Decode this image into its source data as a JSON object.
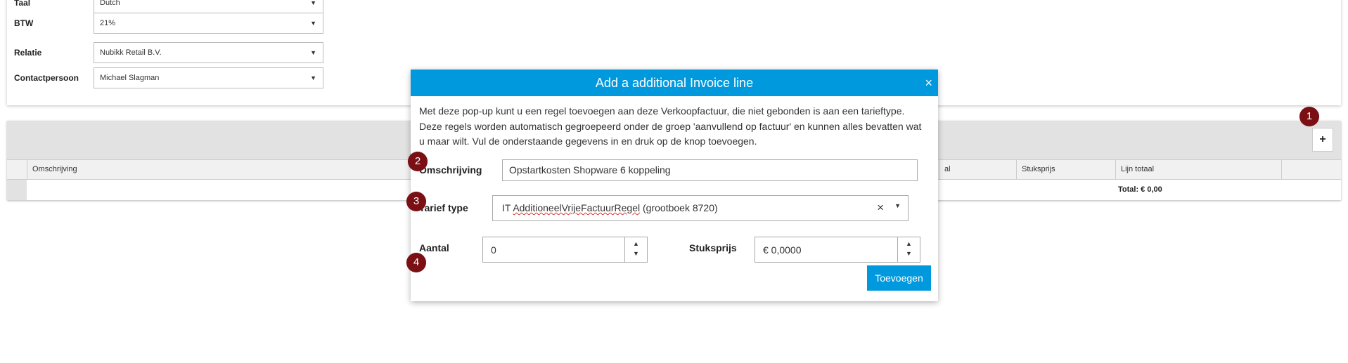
{
  "settings": {
    "rows": [
      {
        "label": "Taal",
        "value": "Dutch"
      },
      {
        "label": "BTW",
        "value": "21%"
      },
      {
        "label": "Relatie",
        "value": "Nubikk Retail B.V."
      },
      {
        "label": "Contactpersoon",
        "value": "Michael Slagman"
      }
    ]
  },
  "lines_table": {
    "add_button": "+",
    "columns": [
      "Omschrijving",
      "al",
      "Stuksprijs",
      "Lijn totaal"
    ],
    "total": "Total: € 0,00"
  },
  "modal": {
    "title": "Add a additional Invoice line",
    "close": "×",
    "description": "Met deze pop-up kunt u een regel toevoegen aan deze Verkoopfactuur, die niet gebonden is aan een tarieftype. Deze regels worden automatisch gegroepeerd onder de groep 'aanvullend op factuur' en kunnen alles bevatten wat u maar wilt. Vul de onderstaande gegevens in en druk op de knop toevoegen.",
    "omschrijving_label": "Omschrijving",
    "omschrijving_value": "Opstartkosten Shopware 6 koppeling",
    "tarief_label": "Tarief type",
    "tarief_value_prefix": "IT ",
    "tarief_value_misspelled": "AdditioneelVrijeFactuurRegel",
    "tarief_value_suffix": " (grootboek 8720)",
    "aantal_label": "Aantal",
    "aantal_value": "0",
    "stuksprijs_label": "Stuksprijs",
    "stuksprijs_value": "€ 0,0000",
    "submit_label": "Toevoegen"
  },
  "markers": [
    "1",
    "2",
    "3",
    "4"
  ],
  "colors": {
    "accent": "#0099dd",
    "marker": "#7a0f14"
  }
}
